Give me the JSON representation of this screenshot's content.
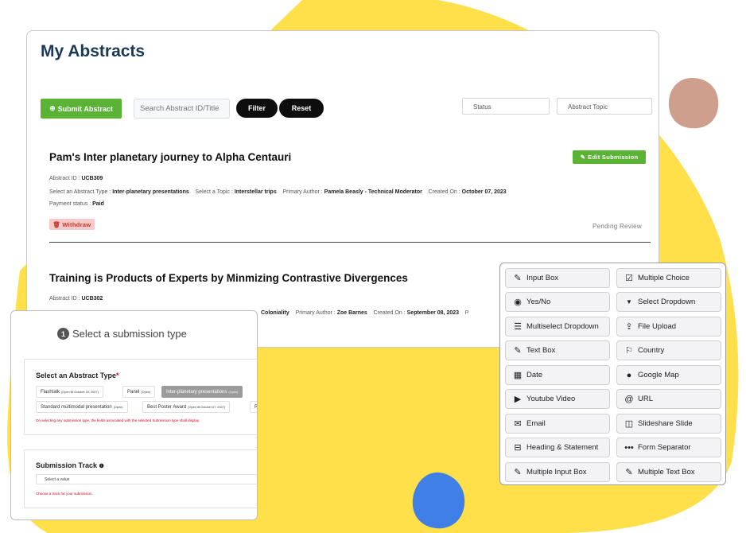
{
  "header": {
    "title": "My Abstracts"
  },
  "toolbar": {
    "submit_label": "Submit Abstract",
    "search_placeholder": "Search Abstract ID/Title",
    "filter_label": "Filter",
    "reset_label": "Reset",
    "status_placeholder": "Status",
    "topic_placeholder": "Abstract Topic"
  },
  "abstracts": [
    {
      "title": "Pam's Inter planetary journey to Alpha Centauri",
      "id_label": "Abstract ID :",
      "id_value": "UCB309",
      "type_label": "Select an Abstract Type :",
      "type_value": "Inter-planetary presentations",
      "topic_label": "Select a Topic :",
      "topic_value": "Interstellar trips",
      "author_label": "Primary Author :",
      "author_value": "Pamela Beasly - Technical Moderator",
      "created_label": "Created On :",
      "created_value": "October 07, 2023",
      "payment_label": "Payment status :",
      "payment_value": "Paid",
      "edit_label": "Edit Submission",
      "withdraw_label": "Withdraw",
      "status": "Pending Review"
    },
    {
      "title": "Training is Products of Experts by Minmizing Contrastive Divergences",
      "id_label": "Abstract ID :",
      "id_value": "UCB302",
      "topic_value": "Coloniality",
      "author_label": "Primary Author :",
      "author_value": "Zoe Barnes",
      "created_label": "Created On :",
      "created_value": "September 08, 2023",
      "trailing": "P"
    }
  ],
  "submission_type": {
    "step_number": "1",
    "heading": "Select a submission type",
    "abstract_type_label": "Select an Abstract Type",
    "required_mark": "*",
    "options": [
      {
        "label": "Flashtalk",
        "note": "(Open till October 20, 2027)"
      },
      {
        "label": "Panel",
        "note": "(Open)"
      },
      {
        "label": "Inter-planetary presentations",
        "note": "(Open)",
        "selected": true
      },
      {
        "label": "Standard multimodal presentation",
        "note": "(Open)"
      },
      {
        "label": "Best Poster Award",
        "note": "(Open till October 07, 2027)"
      },
      {
        "label": "R",
        "note": ""
      }
    ],
    "note": "On selecting any submission type, the fields associated with the selected Submission type shall display.",
    "track_label": "Submission Track",
    "track_placeholder": "Select a value",
    "track_error": "Choose a track for your submission."
  },
  "form_fields": [
    {
      "label": "Input Box",
      "icon": "edit-icon"
    },
    {
      "label": "Multiple Choice",
      "icon": "checkbox-icon"
    },
    {
      "label": "Yes/No",
      "icon": "radio-icon"
    },
    {
      "label": "Select Dropdown",
      "icon": "caret-down-icon"
    },
    {
      "label": "Multiselect Dropdown",
      "icon": "list-icon"
    },
    {
      "label": "File Upload",
      "icon": "upload-icon"
    },
    {
      "label": "Text Box",
      "icon": "edit-icon"
    },
    {
      "label": "Country",
      "icon": "flag-icon"
    },
    {
      "label": "Date",
      "icon": "calendar-icon"
    },
    {
      "label": "Google Map",
      "icon": "globe-icon"
    },
    {
      "label": "Youtube Video",
      "icon": "youtube-icon"
    },
    {
      "label": "URL",
      "icon": "at-icon"
    },
    {
      "label": "Email",
      "icon": "envelope-icon"
    },
    {
      "label": "Slideshare Slide",
      "icon": "slideshare-icon"
    },
    {
      "label": "Heading & Statement",
      "icon": "heading-icon"
    },
    {
      "label": "Form Separator",
      "icon": "dots-icon"
    },
    {
      "label": "Multiple Input Box",
      "icon": "edit-icon"
    },
    {
      "label": "Multiple Text Box",
      "icon": "edit-icon"
    }
  ],
  "colors": {
    "accent_green": "#5ab334",
    "title_navy": "#1b3a57",
    "blob_yellow": "#ffe04a",
    "blob_brown": "#cd9f8c",
    "blob_blue": "#3f7fe6",
    "danger_red": "#d0021b"
  }
}
